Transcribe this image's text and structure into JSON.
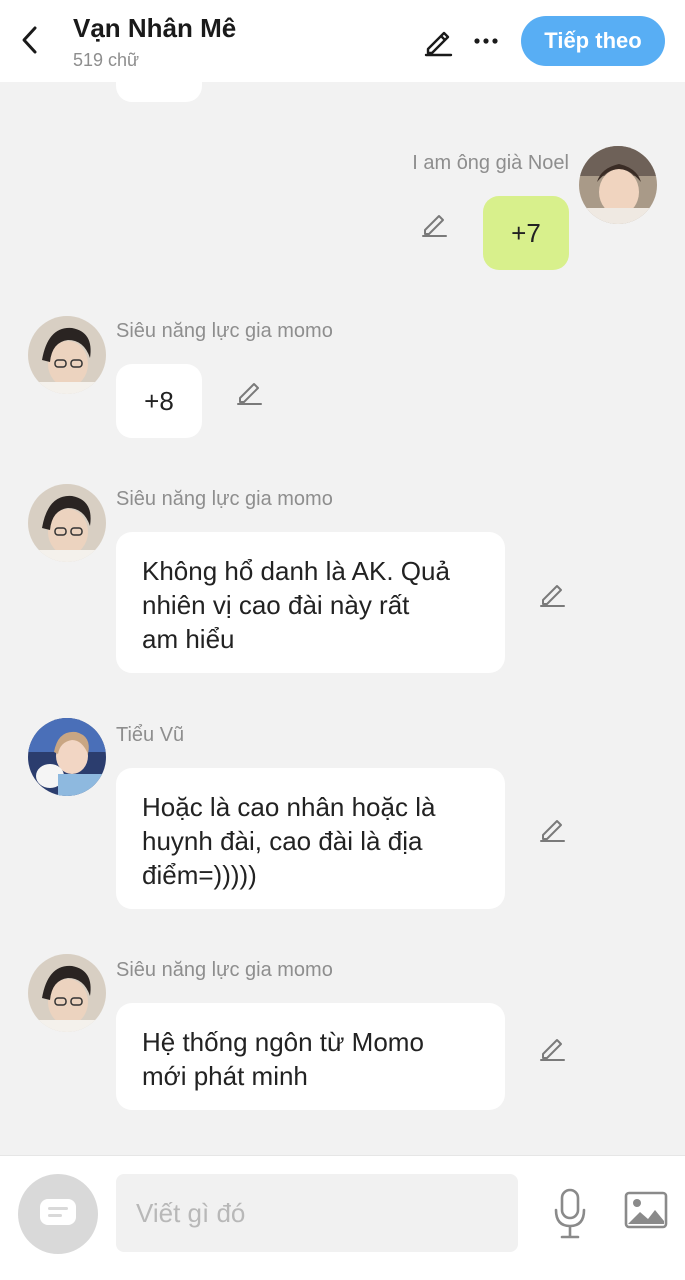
{
  "header": {
    "title": "Vạn Nhân Mê",
    "subtitle": "519 chữ",
    "next_label": "Tiếp theo"
  },
  "messages": [
    {
      "sender": "",
      "text": "",
      "own": false
    },
    {
      "sender": "I am ông già Noel",
      "text": "+7",
      "own": true
    },
    {
      "sender": "Siêu năng lực gia momo",
      "text": "+8",
      "own": false
    },
    {
      "sender": "Siêu năng lực gia momo",
      "lines": [
        "Không hổ danh là AK. Quả",
        "nhiên vị cao đài này rất",
        "am hiểu"
      ],
      "own": false
    },
    {
      "sender": "Tiểu Vũ",
      "lines": [
        "Hoặc là cao nhân hoặc là",
        "huynh đài, cao đài là địa",
        "điểm=)))))"
      ],
      "own": false
    },
    {
      "sender": "Siêu năng lực gia momo",
      "lines": [
        "Hệ thống ngôn từ Momo",
        "mới phát minh"
      ],
      "own": false
    }
  ],
  "composer": {
    "placeholder": "Viết gì đó"
  },
  "icons": {
    "back": "chevron-left-icon",
    "edit": "pencil-icon",
    "more": "more-dots-icon",
    "chat_mode": "chat-bubble-icon",
    "mic": "microphone-icon",
    "image": "image-icon"
  },
  "colors": {
    "accent": "#58aef4",
    "own_bubble": "#d8f08c",
    "background": "#f2f2f2"
  }
}
